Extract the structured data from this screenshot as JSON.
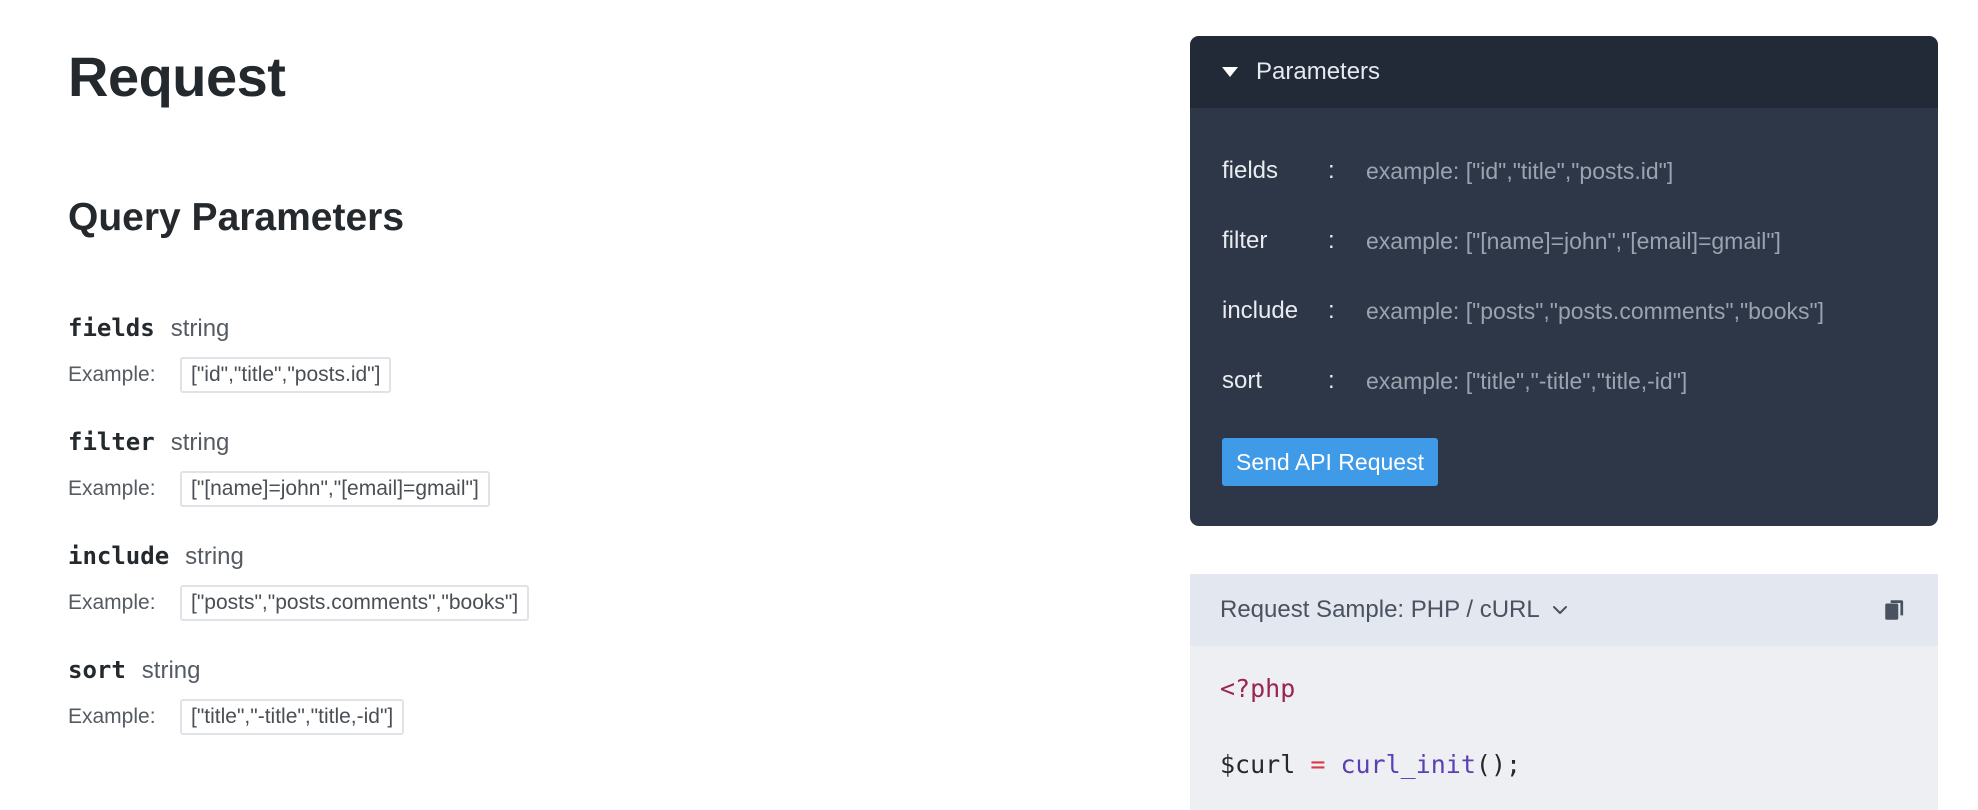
{
  "page": {
    "title": "Request",
    "section_title": "Query Parameters"
  },
  "params": [
    {
      "name": "fields",
      "type": "string",
      "example_label": "Example:",
      "example": "[\"id\",\"title\",\"posts.id\"]"
    },
    {
      "name": "filter",
      "type": "string",
      "example_label": "Example:",
      "example": "[\"[name]=john\",\"[email]=gmail\"]"
    },
    {
      "name": "include",
      "type": "string",
      "example_label": "Example:",
      "example": "[\"posts\",\"posts.comments\",\"books\"]"
    },
    {
      "name": "sort",
      "type": "string",
      "example_label": "Example:",
      "example": "[\"title\",\"-title\",\"title,-id\"]"
    }
  ],
  "panel": {
    "header": "Parameters",
    "fields": [
      {
        "label": "fields",
        "colon": ":",
        "value": "",
        "placeholder": "example: [\"id\",\"title\",\"posts.id\"]"
      },
      {
        "label": "filter",
        "colon": ":",
        "value": "",
        "placeholder": "example: [\"[name]=john\",\"[email]=gmail\"]"
      },
      {
        "label": "include",
        "colon": ":",
        "value": "",
        "placeholder": "example: [\"posts\",\"posts.comments\",\"books\"]"
      },
      {
        "label": "sort",
        "colon": ":",
        "value": "",
        "placeholder": "example: [\"title\",\"-title\",\"title,-id\"]"
      }
    ],
    "send_button": "Send API Request"
  },
  "sample": {
    "label": "Request Sample: PHP / cURL",
    "code": {
      "line1": "<?php",
      "line3_var": "$curl ",
      "line3_op": "=",
      "line3_fn": "curl_init",
      "line3_tail": "();"
    }
  },
  "icons": {
    "panel_caret": "caret-down-icon",
    "sample_chevron": "chevron-down-icon",
    "copy": "copy-icon"
  },
  "colors": {
    "panel_bg": "#2d3748",
    "panel_header_bg": "#222a38",
    "button": "#3f9ae8",
    "sample_header_bg": "#e3e7ef",
    "sample_bg": "#edeff3"
  }
}
